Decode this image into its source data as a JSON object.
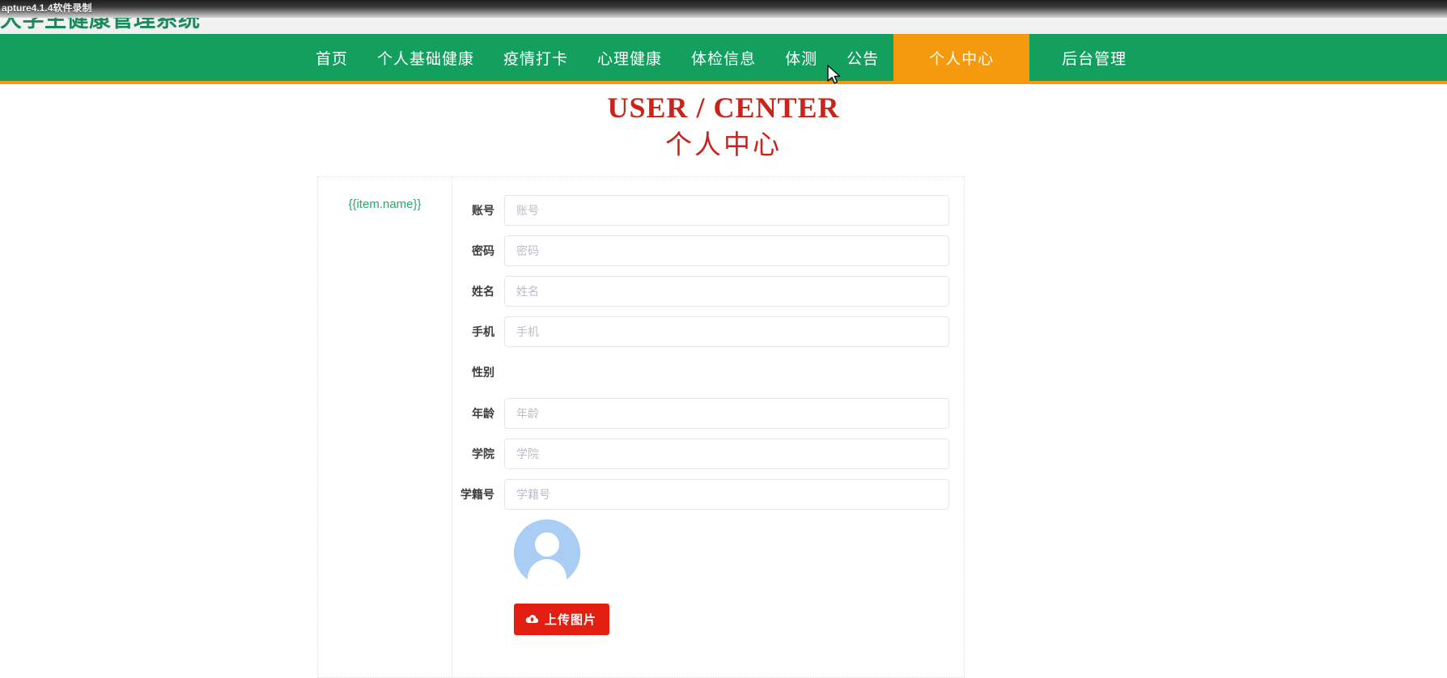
{
  "recorder": {
    "window_title": "apture4.1.4软件录制"
  },
  "site": {
    "title": "大学生健康管理系统"
  },
  "nav": {
    "items": [
      {
        "label": "首页",
        "active": false
      },
      {
        "label": "个人基础健康",
        "active": false
      },
      {
        "label": "疫情打卡",
        "active": false
      },
      {
        "label": "心理健康",
        "active": false
      },
      {
        "label": "体检信息",
        "active": false
      },
      {
        "label": "体测",
        "active": false
      },
      {
        "label": "公告",
        "active": false
      },
      {
        "label": "个人中心",
        "active": true
      },
      {
        "label": "后台管理",
        "active": false
      }
    ],
    "bar_color": "#13a05f",
    "active_color": "#f59a0d",
    "underline_color": "#f59a0d"
  },
  "page": {
    "title_en": "USER / CENTER",
    "title_cn": "个人中心",
    "title_color": "#c8241c"
  },
  "panel": {
    "left_label": "{{item.name}}",
    "left_label_color": "#2aa76c"
  },
  "form": {
    "fields": [
      {
        "label": "账号",
        "placeholder": "账号",
        "value": "",
        "has_input": true
      },
      {
        "label": "密码",
        "placeholder": "密码",
        "value": "",
        "has_input": true
      },
      {
        "label": "姓名",
        "placeholder": "姓名",
        "value": "",
        "has_input": true
      },
      {
        "label": "手机",
        "placeholder": "手机",
        "value": "",
        "has_input": true
      },
      {
        "label": "性别",
        "placeholder": "",
        "value": "",
        "has_input": false
      },
      {
        "label": "年龄",
        "placeholder": "年龄",
        "value": "",
        "has_input": true
      },
      {
        "label": "学院",
        "placeholder": "学院",
        "value": "",
        "has_input": true
      },
      {
        "label": "学籍号",
        "placeholder": "学籍号",
        "value": "",
        "has_input": true
      }
    ]
  },
  "avatar": {
    "icon": "user-avatar-placeholder",
    "background_color": "#a9cdf3"
  },
  "upload": {
    "label": "上传图片",
    "icon": "cloud-upload-icon",
    "color": "#e31f12"
  }
}
